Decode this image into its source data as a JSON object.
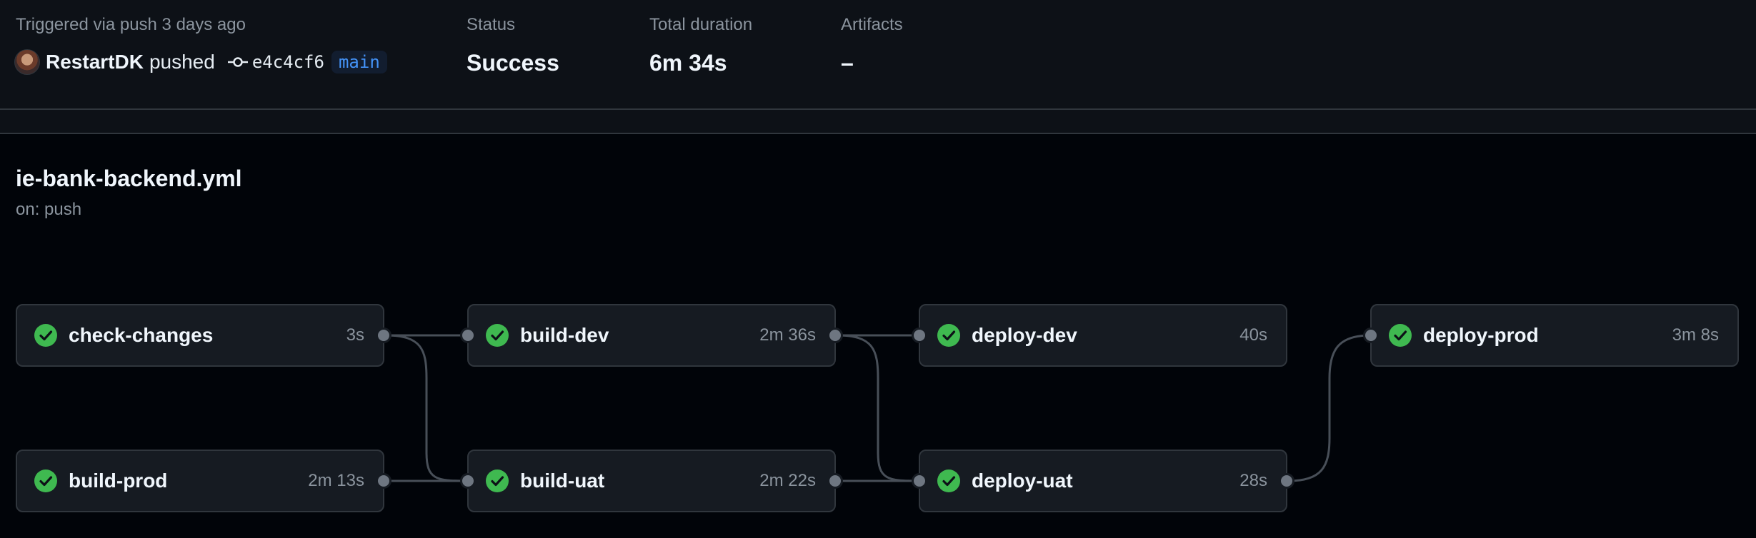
{
  "summary": {
    "trigger_text": "Triggered via push 3 days ago",
    "actor": "RestartDK",
    "action": "pushed",
    "commit_sha": "e4c4cf6",
    "branch": "main",
    "status_label": "Status",
    "status_value": "Success",
    "duration_label": "Total duration",
    "duration_value": "6m 34s",
    "artifacts_label": "Artifacts",
    "artifacts_value": "–"
  },
  "workflow": {
    "file": "ie-bank-backend.yml",
    "trigger": "on: push"
  },
  "jobs": [
    {
      "name": "check-changes",
      "duration": "3s",
      "status": "success"
    },
    {
      "name": "build-dev",
      "duration": "2m 36s",
      "status": "success"
    },
    {
      "name": "deploy-dev",
      "duration": "40s",
      "status": "success"
    },
    {
      "name": "deploy-prod",
      "duration": "3m 8s",
      "status": "success"
    },
    {
      "name": "build-prod",
      "duration": "2m 13s",
      "status": "success"
    },
    {
      "name": "build-uat",
      "duration": "2m 22s",
      "status": "success"
    },
    {
      "name": "deploy-uat",
      "duration": "28s",
      "status": "success"
    }
  ],
  "colors": {
    "success": "#3fb950",
    "background": "#010409",
    "panel": "#161b22",
    "border": "#30363d",
    "branch": "#4493f8"
  },
  "icons": {
    "status": "check-circle-fill-icon",
    "commit": "git-commit-icon"
  }
}
